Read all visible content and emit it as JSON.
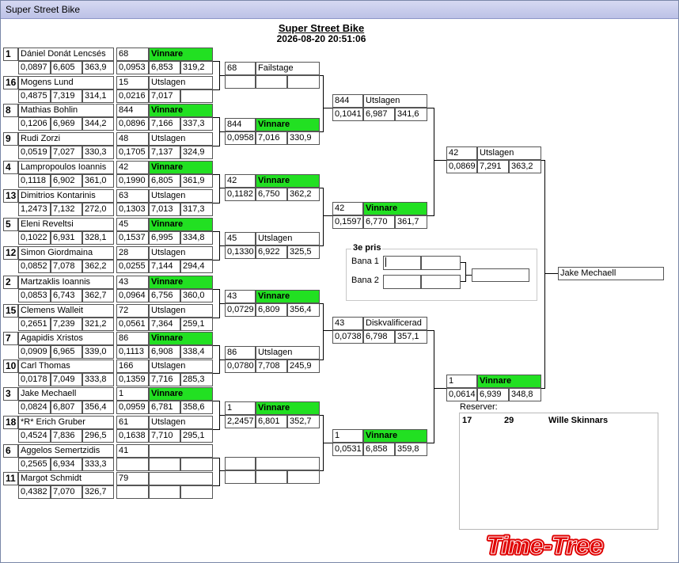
{
  "window": {
    "title": "Super Street Bike"
  },
  "header": {
    "title": "Super Street Bike",
    "datetime": "2026-08-20 20:51:06"
  },
  "round1": [
    {
      "seed": "1",
      "name": "Dániel Donát Lencsés",
      "rt": "0,0897",
      "et": "6,605",
      "spd": "363,9",
      "num": "68",
      "result": "Vinnare",
      "res_rt": "0,0953",
      "res_et": "6,853",
      "res_spd": "319,2",
      "win": true
    },
    {
      "seed": "16",
      "name": "Mogens Lund",
      "rt": "0,4875",
      "et": "7,319",
      "spd": "314,1",
      "num": "15",
      "result": "Utslagen",
      "res_rt": "0,0216",
      "res_et": "7,017",
      "res_spd": "",
      "win": false
    },
    {
      "seed": "8",
      "name": "Mathias Bohlin",
      "rt": "0,1206",
      "et": "6,969",
      "spd": "344,2",
      "num": "844",
      "result": "Vinnare",
      "res_rt": "0,0896",
      "res_et": "7,166",
      "res_spd": "337,3",
      "win": true
    },
    {
      "seed": "9",
      "name": "Rudi Zorzi",
      "rt": "0,0519",
      "et": "7,027",
      "spd": "330,3",
      "num": "48",
      "result": "Utslagen",
      "res_rt": "0,1705",
      "res_et": "7,137",
      "res_spd": "324,9",
      "win": false
    },
    {
      "seed": "4",
      "name": "Lampropoulos  Ioannis",
      "rt": "0,1118",
      "et": "6,902",
      "spd": "361,0",
      "num": "42",
      "result": "Vinnare",
      "res_rt": "0,1990",
      "res_et": "6,805",
      "res_spd": "361,9",
      "win": true
    },
    {
      "seed": "13",
      "name": "Dimitrios Kontarinis",
      "rt": "1,2473",
      "et": "7,132",
      "spd": "272,0",
      "num": "63",
      "result": "Utslagen",
      "res_rt": "0,1303",
      "res_et": "7,013",
      "res_spd": "317,3",
      "win": false
    },
    {
      "seed": "5",
      "name": "Eleni  Reveltsi",
      "rt": "0,1022",
      "et": "6,931",
      "spd": "328,1",
      "num": "45",
      "result": "Vinnare",
      "res_rt": "0,1537",
      "res_et": "6,995",
      "res_spd": "334,8",
      "win": true
    },
    {
      "seed": "12",
      "name": "Simon Giordmaina",
      "rt": "0,0852",
      "et": "7,078",
      "spd": "362,2",
      "num": "28",
      "result": "Utslagen",
      "res_rt": "0,0255",
      "res_et": "7,144",
      "res_spd": "294,4",
      "win": false
    },
    {
      "seed": "2",
      "name": "Martzaklis  Ioannis",
      "rt": "0,0853",
      "et": "6,743",
      "spd": "362,7",
      "num": "43",
      "result": "Vinnare",
      "res_rt": "0,0964",
      "res_et": "6,756",
      "res_spd": "360,0",
      "win": true
    },
    {
      "seed": "15",
      "name": "Clemens Walleit",
      "rt": "0,2651",
      "et": "7,239",
      "spd": "321,2",
      "num": "72",
      "result": "Utslagen",
      "res_rt": "0,0561",
      "res_et": "7,364",
      "res_spd": "259,1",
      "win": false
    },
    {
      "seed": "7",
      "name": "Agapidis Xristos",
      "rt": "0,0909",
      "et": "6,965",
      "spd": "339,0",
      "num": "86",
      "result": "Vinnare",
      "res_rt": "0,1113",
      "res_et": "6,908",
      "res_spd": "338,4",
      "win": true
    },
    {
      "seed": "10",
      "name": "Carl  Thomas",
      "rt": "0,0178",
      "et": "7,049",
      "spd": "333,8",
      "num": "166",
      "result": "Utslagen",
      "res_rt": "0,1359",
      "res_et": "7,716",
      "res_spd": "285,3",
      "win": false
    },
    {
      "seed": "3",
      "name": "Jake Mechaell",
      "rt": "0,0824",
      "et": "6,807",
      "spd": "356,4",
      "num": "1",
      "result": "Vinnare",
      "res_rt": "0,0959",
      "res_et": "6,781",
      "res_spd": "358,6",
      "win": true
    },
    {
      "seed": "18",
      "name": "*R* Erich Gruber",
      "rt": "0,4524",
      "et": "7,836",
      "spd": "296,5",
      "num": "61",
      "result": "Utslagen",
      "res_rt": "0,1638",
      "res_et": "7,710",
      "res_spd": "295,1",
      "win": false
    },
    {
      "seed": "6",
      "name": "Aggelos Semertzidis",
      "rt": "0,2565",
      "et": "6,934",
      "spd": "333,3",
      "num": "41",
      "result": "",
      "res_rt": "",
      "res_et": "",
      "res_spd": "",
      "win": false
    },
    {
      "seed": "11",
      "name": "Margot Schmidt",
      "rt": "0,4382",
      "et": "7,070",
      "spd": "326,7",
      "num": "79",
      "result": "",
      "res_rt": "",
      "res_et": "",
      "res_spd": "",
      "win": false
    }
  ],
  "round2": [
    {
      "num": "68",
      "result": "Failstage",
      "rt": "",
      "et": "",
      "spd": "",
      "win": false
    },
    {
      "num": "844",
      "result": "Vinnare",
      "rt": "0,0958",
      "et": "7,016",
      "spd": "330,9",
      "win": true
    },
    {
      "num": "42",
      "result": "Vinnare",
      "rt": "0,1182",
      "et": "6,750",
      "spd": "362,2",
      "win": true
    },
    {
      "num": "45",
      "result": "Utslagen",
      "rt": "0,1330",
      "et": "6,922",
      "spd": "325,5",
      "win": false
    },
    {
      "num": "43",
      "result": "Vinnare",
      "rt": "0,0729",
      "et": "6,809",
      "spd": "356,4",
      "win": true
    },
    {
      "num": "86",
      "result": "Utslagen",
      "rt": "0,0780",
      "et": "7,708",
      "spd": "245,9",
      "win": false
    },
    {
      "num": "1",
      "result": "Vinnare",
      "rt": "2,2457",
      "et": "6,801",
      "spd": "352,7",
      "win": true
    },
    {
      "num": "",
      "result": "",
      "rt": "",
      "et": "",
      "spd": "",
      "win": false
    }
  ],
  "round3": [
    {
      "num": "844",
      "result": "Utslagen",
      "rt": "0,1041",
      "et": "6,987",
      "spd": "341,6",
      "win": false
    },
    {
      "num": "42",
      "result": "Vinnare",
      "rt": "0,1597",
      "et": "6,770",
      "spd": "361,7",
      "win": true
    },
    {
      "num": "43",
      "result": "Diskvalificerad",
      "rt": "0,0738",
      "et": "6,798",
      "spd": "357,1",
      "win": false
    },
    {
      "num": "1",
      "result": "Vinnare",
      "rt": "0,0531",
      "et": "6,858",
      "spd": "359,8",
      "win": true
    }
  ],
  "round4": [
    {
      "num": "42",
      "result": "Utslagen",
      "rt": "0,0869",
      "et": "7,291",
      "spd": "363,2",
      "win": false
    },
    {
      "num": "1",
      "result": "Vinnare",
      "rt": "0,0614",
      "et": "6,939",
      "spd": "348,8",
      "win": true
    }
  ],
  "final": {
    "winner": "Jake Mechaell"
  },
  "third_prize": {
    "title": "3e pris",
    "lane1": "Bana 1",
    "lane2": "Bana 2"
  },
  "reserves": {
    "label": "Reserver:",
    "rows": [
      {
        "seed": "17",
        "num": "29",
        "name": "Wille Skinnars"
      }
    ]
  },
  "logo": {
    "text": "Time-Tree",
    "color": "#e00000"
  }
}
